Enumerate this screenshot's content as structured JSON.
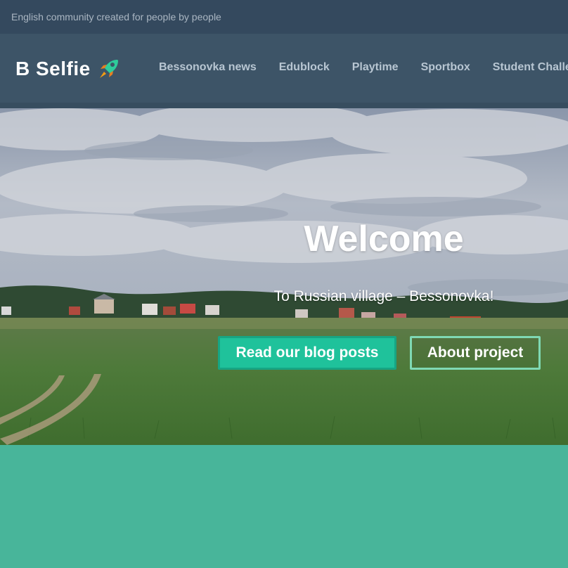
{
  "topbar": {
    "tagline": "English community created for people by people"
  },
  "brand": {
    "name": "B Selfie",
    "icon": "rocket-icon"
  },
  "nav": {
    "items": [
      {
        "label": "Bessonovka news"
      },
      {
        "label": "Edublock"
      },
      {
        "label": "Playtime"
      },
      {
        "label": "Sportbox"
      },
      {
        "label": "Student Challenge"
      }
    ]
  },
  "hero": {
    "title": "Welcome",
    "subtitle": "To Russian village – Bessonovka!",
    "primary_button": "Read our blog posts",
    "secondary_button": "About project"
  },
  "colors": {
    "topbar": "#34495e",
    "navbar": "#3d5467",
    "accent": "#1fc29b",
    "band": "#48b59a"
  }
}
